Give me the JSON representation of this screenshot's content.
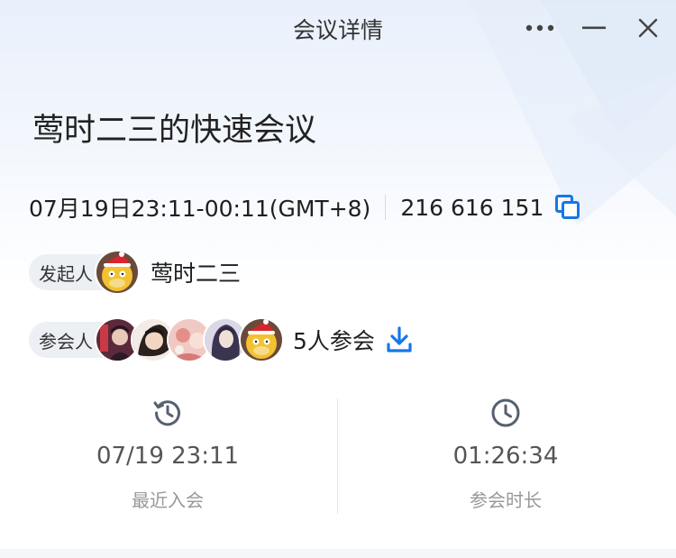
{
  "window": {
    "title": "会议详情"
  },
  "meeting": {
    "title": "莺时二三的快速会议",
    "time_range": "07月19日23:11-00:11(GMT+8)",
    "meeting_id": "216 616 151"
  },
  "host": {
    "label": "发起人",
    "name": "莺时二三"
  },
  "attendees": {
    "label": "参会人",
    "count_text": "5人参会"
  },
  "stats": {
    "last_join": {
      "value": "07/19 23:11",
      "label": "最近入会"
    },
    "duration": {
      "value": "01:26:34",
      "label": "参会时长"
    }
  },
  "icons": {
    "more": "more-icon",
    "minimize": "minimize-icon",
    "close": "close-icon",
    "copy": "copy-icon",
    "download": "download-icon",
    "history": "history-clock-icon",
    "duration": "clock-icon"
  },
  "colors": {
    "accent": "#1677e6",
    "text_primary": "#1f1f1f",
    "text_secondary": "#999999",
    "pill_bg": "#eceff3"
  }
}
